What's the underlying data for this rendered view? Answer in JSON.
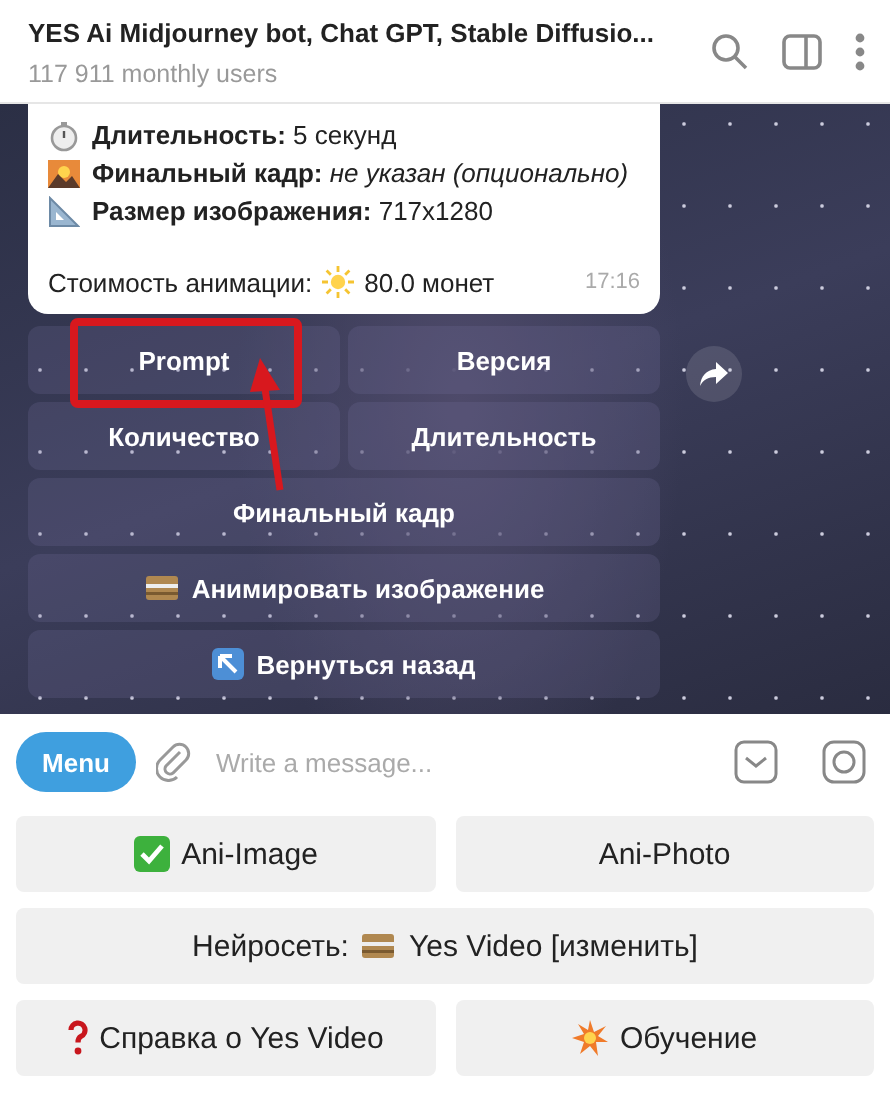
{
  "header": {
    "title": "YES Ai Midjourney bot, Chat GPT, Stable Diffusio...",
    "subtitle": "117 911 monthly users"
  },
  "message": {
    "lines": [
      "**Длительность:** 5 секунд",
      "**Финальный кадр:** *не указан (опционально)*",
      "**Размер изображения:** 717x1280"
    ],
    "cost_label": "Стоимость анимации:",
    "cost_value": "80.0 монет",
    "time": "17:16"
  },
  "inline_keyboard": [
    [
      {
        "label": "Prompt",
        "highlighted": true
      },
      {
        "label": "Версия",
        "highlighted": false
      }
    ],
    [
      {
        "label": "Количество",
        "highlighted": false
      },
      {
        "label": "Длительность",
        "highlighted": false
      }
    ],
    [
      {
        "label": "Финальный кадр",
        "highlighted": false
      }
    ],
    [
      {
        "label": "Анимировать изображение",
        "highlighted": false
      }
    ],
    [
      {
        "label": "Вернуться назад",
        "highlighted": false
      }
    ]
  ],
  "input": {
    "menu": "Menu",
    "placeholder": "Write a message..."
  },
  "reply_keyboard": [
    [
      {
        "label": "Ani-Image"
      },
      {
        "label": "Ani-Photo"
      }
    ],
    [
      {
        "prefix": "Нейросеть:",
        "label": "Yes Video [изменить]"
      }
    ],
    [
      {
        "label": "Справка о Yes Video"
      },
      {
        "label": "Обучение"
      }
    ]
  ]
}
